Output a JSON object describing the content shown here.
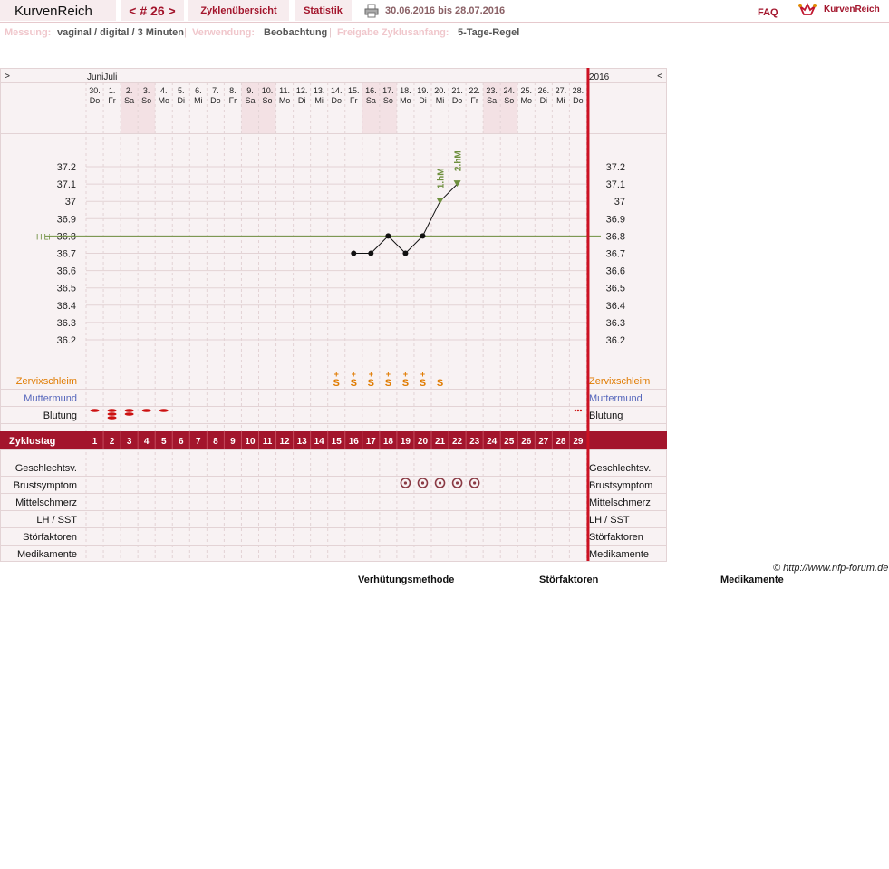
{
  "header": {
    "logo": "KurvenReich",
    "cycle_label": "< # 26 >",
    "tab_overview": "Zyklenübersicht",
    "tab_stats": "Statistik",
    "date_range": "30.06.2016 bis 28.07.2016",
    "faq": "FAQ",
    "brand": "KurvenReich"
  },
  "meta": {
    "measure_label": "Messung:",
    "measure_value": "vaginal / digital / 3 Minuten",
    "usage_label": "Verwendung:",
    "usage_value": "Beobachtung",
    "release_label": "Freigabe Zyklusanfang:",
    "release_value": "5-Tage-Regel"
  },
  "nav": {
    "prev": ">",
    "next": "<",
    "months": "JuniJuli",
    "year": "2016"
  },
  "days": [
    {
      "d": "30.",
      "w": "Do"
    },
    {
      "d": "1.",
      "w": "Fr"
    },
    {
      "d": "2.",
      "w": "Sa"
    },
    {
      "d": "3.",
      "w": "So"
    },
    {
      "d": "4.",
      "w": "Mo"
    },
    {
      "d": "5.",
      "w": "Di"
    },
    {
      "d": "6.",
      "w": "Mi"
    },
    {
      "d": "7.",
      "w": "Do"
    },
    {
      "d": "8.",
      "w": "Fr"
    },
    {
      "d": "9.",
      "w": "Sa"
    },
    {
      "d": "10.",
      "w": "So"
    },
    {
      "d": "11.",
      "w": "Mo"
    },
    {
      "d": "12.",
      "w": "Di"
    },
    {
      "d": "13.",
      "w": "Mi"
    },
    {
      "d": "14.",
      "w": "Do"
    },
    {
      "d": "15.",
      "w": "Fr"
    },
    {
      "d": "16.",
      "w": "Sa"
    },
    {
      "d": "17.",
      "w": "So"
    },
    {
      "d": "18.",
      "w": "Mo"
    },
    {
      "d": "19.",
      "w": "Di"
    },
    {
      "d": "20.",
      "w": "Mi"
    },
    {
      "d": "21.",
      "w": "Do"
    },
    {
      "d": "22.",
      "w": "Fr"
    },
    {
      "d": "23.",
      "w": "Sa"
    },
    {
      "d": "24.",
      "w": "So"
    },
    {
      "d": "25.",
      "w": "Mo"
    },
    {
      "d": "26.",
      "w": "Di"
    },
    {
      "d": "27.",
      "w": "Mi"
    },
    {
      "d": "28.",
      "w": "Do"
    }
  ],
  "weekend_indices": [
    2,
    3,
    9,
    10,
    16,
    17,
    23,
    24
  ],
  "temp_ticks": [
    "37.2",
    "37.1",
    "37",
    "36.9",
    "36.8",
    "36.7",
    "36.6",
    "36.5",
    "36.4",
    "36.3",
    "36.2"
  ],
  "hili_label": "HiLi",
  "hili_value": 36.8,
  "temperatures": [
    {
      "cycle_day": 16,
      "temp": 36.7
    },
    {
      "cycle_day": 17,
      "temp": 36.7
    },
    {
      "cycle_day": 18,
      "temp": 36.8
    },
    {
      "cycle_day": 19,
      "temp": 36.7
    },
    {
      "cycle_day": 20,
      "temp": 36.8
    },
    {
      "cycle_day": 21,
      "temp": 37.0,
      "marker": "1.hM"
    },
    {
      "cycle_day": 22,
      "temp": 37.1,
      "marker": "2.hM"
    }
  ],
  "rows": {
    "cervical": "Zervixschleim",
    "cervix": "Muttermund",
    "bleeding": "Blutung",
    "cycle_day": "Zyklustag",
    "intercourse": "Geschlechtsv.",
    "breast": "Brustsymptom",
    "midpain": "Mittelschmerz",
    "lh": "LH / SST",
    "disturb": "Störfaktoren",
    "meds": "Medikamente"
  },
  "cervical_entries": [
    {
      "cycle_day": 15,
      "symbol": "S+"
    },
    {
      "cycle_day": 16,
      "symbol": "S+"
    },
    {
      "cycle_day": 17,
      "symbol": "S+"
    },
    {
      "cycle_day": 18,
      "symbol": "S+"
    },
    {
      "cycle_day": 19,
      "symbol": "S+"
    },
    {
      "cycle_day": 20,
      "symbol": "S+"
    },
    {
      "cycle_day": 21,
      "symbol": "S"
    }
  ],
  "bleeding_entries": [
    {
      "cycle_day": 1,
      "level": "light"
    },
    {
      "cycle_day": 2,
      "level": "heavy"
    },
    {
      "cycle_day": 3,
      "level": "medium"
    },
    {
      "cycle_day": 4,
      "level": "light"
    },
    {
      "cycle_day": 5,
      "level": "light"
    },
    {
      "cycle_day": 29,
      "level": "spotting"
    }
  ],
  "breast_days": [
    19,
    20,
    21,
    22,
    23
  ],
  "cycle_days": [
    "1",
    "2",
    "3",
    "4",
    "5",
    "6",
    "7",
    "8",
    "9",
    "10",
    "11",
    "12",
    "13",
    "14",
    "15",
    "16",
    "17",
    "18",
    "19",
    "20",
    "21",
    "22",
    "23",
    "24",
    "25",
    "26",
    "27",
    "28",
    "29"
  ],
  "copyright": "© http://www.nfp-forum.de",
  "footer": {
    "method": "Verhütungsmethode",
    "disturb": "Störfaktoren",
    "meds": "Medikamente"
  },
  "colors": {
    "accent": "#a3152c",
    "weekend": "#f3e1e4",
    "panel": "#f8f2f3",
    "grid": "#e3d3d5",
    "hili": "#6e8f3e",
    "cervical": "#e07b00",
    "cervix": "#5566bb",
    "bleeding": "#cc1111",
    "breast": "#8a3a44"
  }
}
